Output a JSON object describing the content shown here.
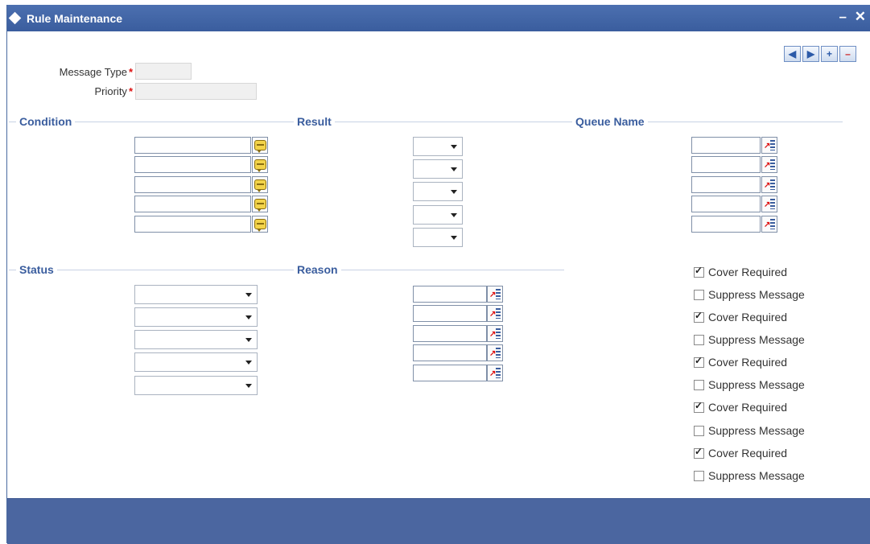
{
  "window": {
    "title": "Rule Maintenance",
    "minimize": "–",
    "close": "✕"
  },
  "nav": {
    "prev": "◀",
    "next": "▶",
    "add": "+",
    "delete": "–"
  },
  "header": {
    "message_type_label": "Message Type",
    "priority_label": "Priority",
    "required_mark": "*"
  },
  "sections": {
    "condition": "Condition",
    "result": "Result",
    "queue_name": "Queue Name",
    "status": "Status",
    "reason": "Reason"
  },
  "options": [
    {
      "cover_label": "Cover Required",
      "cover_checked": true,
      "suppress_label": "Suppress Message",
      "suppress_checked": false
    },
    {
      "cover_label": "Cover Required",
      "cover_checked": true,
      "suppress_label": "Suppress Message",
      "suppress_checked": false
    },
    {
      "cover_label": "Cover Required",
      "cover_checked": true,
      "suppress_label": "Suppress Message",
      "suppress_checked": false
    },
    {
      "cover_label": "Cover Required",
      "cover_checked": true,
      "suppress_label": "Suppress Message",
      "suppress_checked": false
    },
    {
      "cover_label": "Cover Required",
      "cover_checked": true,
      "suppress_label": "Suppress Message",
      "suppress_checked": false
    }
  ],
  "colors": {
    "titlebar": "#3a5d9e",
    "accent": "#3a5d9e",
    "required": "#d11111"
  }
}
